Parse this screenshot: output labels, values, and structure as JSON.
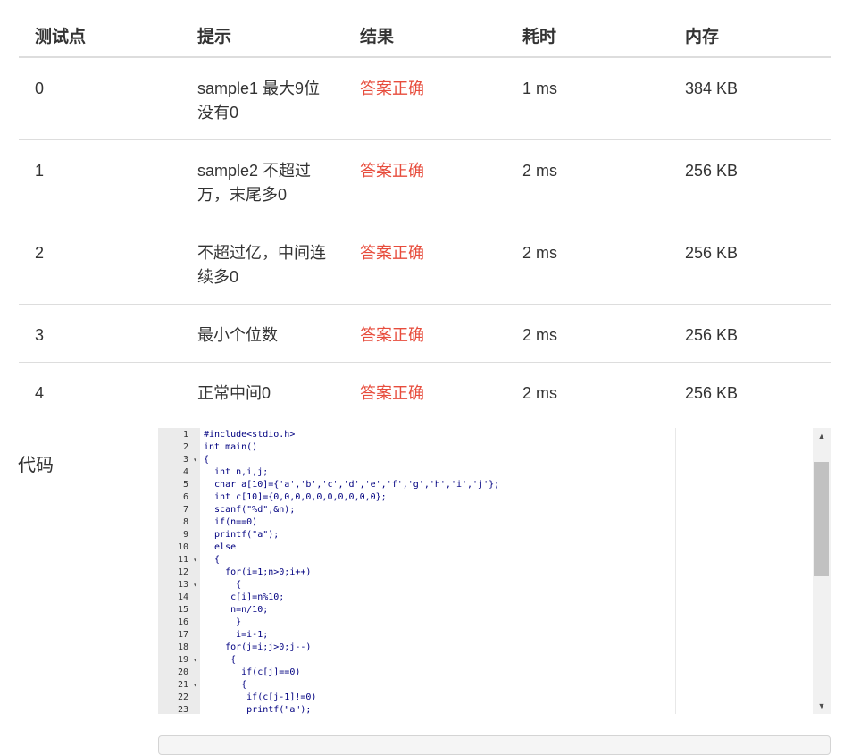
{
  "results_table": {
    "headers": [
      "测试点",
      "提示",
      "结果",
      "耗时",
      "内存"
    ],
    "rows": [
      {
        "point": "0",
        "hint": "sample1 最大9位没有0",
        "result": "答案正确",
        "time": "1 ms",
        "memory": "384 KB"
      },
      {
        "point": "1",
        "hint": "sample2 不超过万，末尾多0",
        "result": "答案正确",
        "time": "2 ms",
        "memory": "256 KB"
      },
      {
        "point": "2",
        "hint": "不超过亿，中间连续多0",
        "result": "答案正确",
        "time": "2 ms",
        "memory": "256 KB"
      },
      {
        "point": "3",
        "hint": "最小个位数",
        "result": "答案正确",
        "time": "2 ms",
        "memory": "256 KB"
      },
      {
        "point": "4",
        "hint": "正常中间0",
        "result": "答案正确",
        "time": "2 ms",
        "memory": "256 KB"
      }
    ]
  },
  "code_section": {
    "label": "代码",
    "lines": [
      {
        "n": "1",
        "fold": false,
        "code": "#include<stdio.h>"
      },
      {
        "n": "2",
        "fold": false,
        "code": "int main()"
      },
      {
        "n": "3",
        "fold": true,
        "code": "{"
      },
      {
        "n": "4",
        "fold": false,
        "code": "  int n,i,j;"
      },
      {
        "n": "5",
        "fold": false,
        "code": "  char a[10]={'a','b','c','d','e','f','g','h','i','j'};"
      },
      {
        "n": "6",
        "fold": false,
        "code": "  int c[10]={0,0,0,0,0,0,0,0,0,0};"
      },
      {
        "n": "7",
        "fold": false,
        "code": "  scanf(\"%d\",&n);"
      },
      {
        "n": "8",
        "fold": false,
        "code": "  if(n==0)"
      },
      {
        "n": "9",
        "fold": false,
        "code": "  printf(\"a\");"
      },
      {
        "n": "10",
        "fold": false,
        "code": "  else"
      },
      {
        "n": "11",
        "fold": true,
        "code": "  {"
      },
      {
        "n": "12",
        "fold": false,
        "code": "    for(i=1;n>0;i++)"
      },
      {
        "n": "13",
        "fold": true,
        "code": "      {"
      },
      {
        "n": "14",
        "fold": false,
        "code": "     c[i]=n%10;"
      },
      {
        "n": "15",
        "fold": false,
        "code": "     n=n/10;"
      },
      {
        "n": "16",
        "fold": false,
        "code": "      }"
      },
      {
        "n": "17",
        "fold": false,
        "code": "      i=i-1;"
      },
      {
        "n": "18",
        "fold": false,
        "code": "    for(j=i;j>0;j--)"
      },
      {
        "n": "19",
        "fold": true,
        "code": "     {"
      },
      {
        "n": "20",
        "fold": false,
        "code": "       if(c[j]==0)"
      },
      {
        "n": "21",
        "fold": true,
        "code": "       {"
      },
      {
        "n": "22",
        "fold": false,
        "code": "        if(c[j-1]!=0)"
      },
      {
        "n": "23",
        "fold": false,
        "code": "        printf(\"a\");"
      }
    ]
  },
  "icons": {
    "fold": "fold-arrow-icon",
    "scroll_up": "scroll-up-arrow-icon",
    "scroll_down": "scroll-down-arrow-icon"
  },
  "scrollbar_thumb_fraction": {
    "start": 0.07,
    "end": 0.52
  },
  "colors": {
    "result_ok": "#e74c3c",
    "code_text": "#000080",
    "gutter_bg": "#ebebeb"
  }
}
